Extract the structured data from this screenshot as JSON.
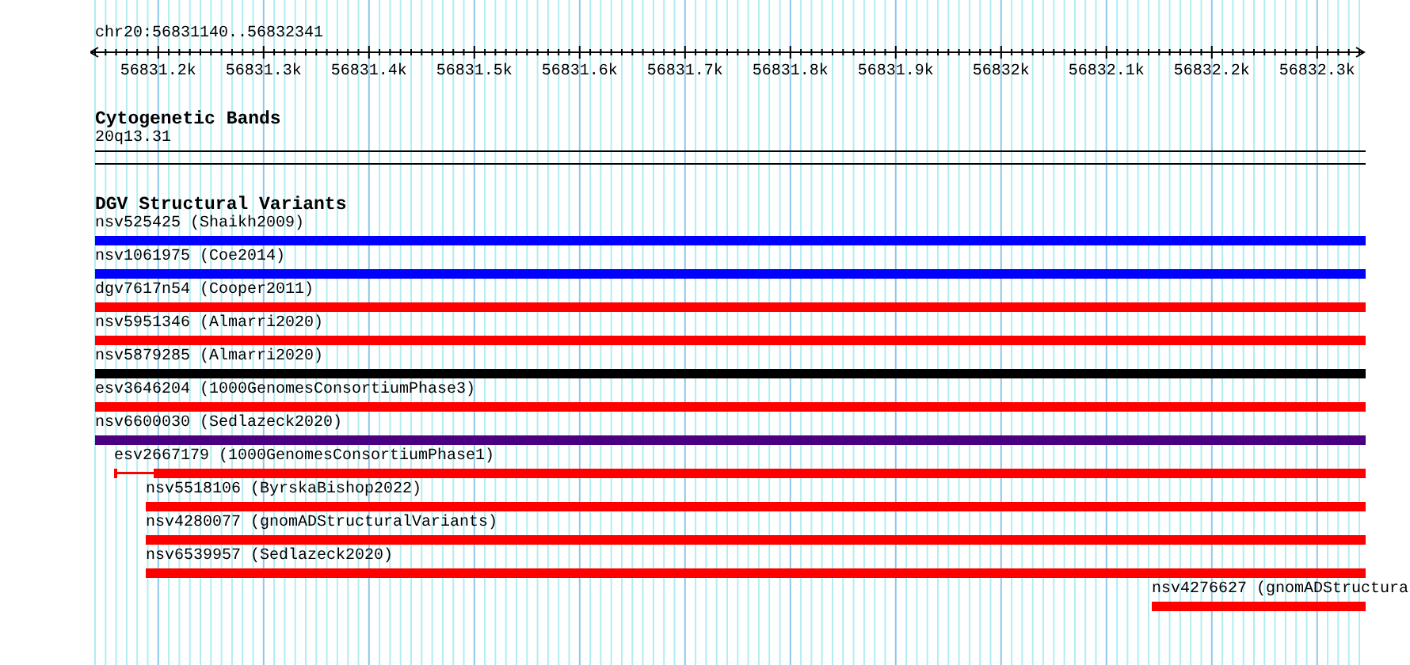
{
  "location": "chr20:56831140..56832341",
  "ruler": {
    "ticks": [
      "56831.2k",
      "56831.3k",
      "56831.4k",
      "56831.5k",
      "56831.6k",
      "56831.7k",
      "56831.8k",
      "56831.9k",
      "56832k",
      "56832.1k",
      "56832.2k",
      "56832.3k"
    ]
  },
  "tracks": [
    {
      "title": "Cytogenetic Bands",
      "band": "20q13.31"
    },
    {
      "title": "DGV Structural Variants",
      "features": [
        {
          "label": "nsv525425 (Shaikh2009)",
          "color": "#0000ff",
          "kind": "bar"
        },
        {
          "label": "nsv1061975 (Coe2014)",
          "color": "#0000ff",
          "kind": "bar"
        },
        {
          "label": "dgv7617n54 (Cooper2011)",
          "color": "#ff0000",
          "kind": "bar"
        },
        {
          "label": "nsv5951346 (Almarri2020)",
          "color": "#ff0000",
          "kind": "bar"
        },
        {
          "label": "nsv5879285 (Almarri2020)",
          "color": "#000000",
          "kind": "bar"
        },
        {
          "label": "esv3646204 (1000GenomesConsortiumPhase3)",
          "color": "#ff0000",
          "kind": "bar"
        },
        {
          "label": "nsv6600030 (Sedlazeck2020)",
          "color": "#4b0082",
          "kind": "bar"
        },
        {
          "label": "esv2667179 (1000GenomesConsortiumPhase1)",
          "color": "#ff0000",
          "kind": "lead"
        },
        {
          "label": "nsv5518106 (ByrskaBishop2022)",
          "color": "#ff0000",
          "kind": "bar"
        },
        {
          "label": "nsv4280077 (gnomADStructuralVariants)",
          "color": "#ff0000",
          "kind": "bar"
        },
        {
          "label": "nsv6539957 (Sedlazeck2020)",
          "color": "#ff0000",
          "kind": "bar"
        },
        {
          "label": "nsv4276627 (gnomADStructura",
          "color": "#ff0000",
          "kind": "bar"
        }
      ]
    }
  ]
}
